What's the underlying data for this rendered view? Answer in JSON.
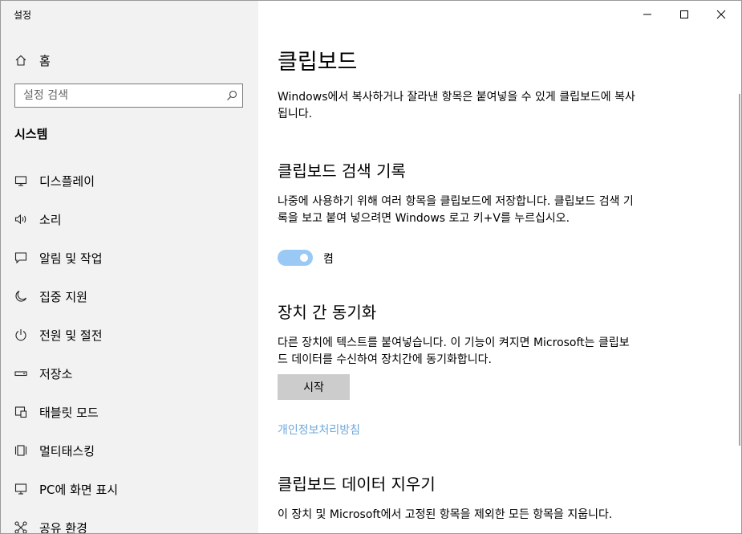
{
  "window": {
    "title": "설정"
  },
  "sidebar": {
    "home_label": "홈",
    "search_placeholder": "설정 검색",
    "section_title": "시스템",
    "items": [
      {
        "label": "디스플레이",
        "icon": "monitor-icon"
      },
      {
        "label": "소리",
        "icon": "speaker-icon"
      },
      {
        "label": "알림 및 작업",
        "icon": "notification-icon"
      },
      {
        "label": "집중 지원",
        "icon": "moon-icon"
      },
      {
        "label": "전원 및 절전",
        "icon": "power-icon"
      },
      {
        "label": "저장소",
        "icon": "storage-icon"
      },
      {
        "label": "태블릿 모드",
        "icon": "tablet-icon"
      },
      {
        "label": "멀티태스킹",
        "icon": "multitasking-icon"
      },
      {
        "label": "PC에 화면 표시",
        "icon": "project-icon"
      },
      {
        "label": "공유 환경",
        "icon": "share-icon"
      }
    ]
  },
  "main": {
    "title": "클립보드",
    "intro": "Windows에서 복사하거나 잘라낸 항목은 붙여넣을 수 있게 클립보드에 복사됩니다.",
    "history": {
      "heading": "클립보드 검색 기록",
      "description": "나중에 사용하기 위해 여러 항목을 클립보드에 저장합니다. 클립보드 검색 기록을 보고 붙여 넣으려면 Windows 로고 키+V를 누르십시오.",
      "toggle_label": "켬",
      "toggle_on": true
    },
    "sync": {
      "heading": "장치 간 동기화",
      "description": "다른 장치에 텍스트를 붙여넣습니다. 이 기능이 켜지면 Microsoft는 클립보드 데이터를 수신하여 장치간에 동기화합니다.",
      "button_label": "시작"
    },
    "privacy_link": "개인정보처리방침",
    "clear": {
      "heading": "클립보드 데이터 지우기",
      "description": "이 장치 및 Microsoft에서 고정된 항목을 제외한 모든 항목을 지웁니다."
    }
  },
  "colors": {
    "sidebar_bg": "#f2f2f2",
    "toggle_on": "#99c9f4",
    "link": "#6fa8dc",
    "button_bg": "#cccccc"
  }
}
